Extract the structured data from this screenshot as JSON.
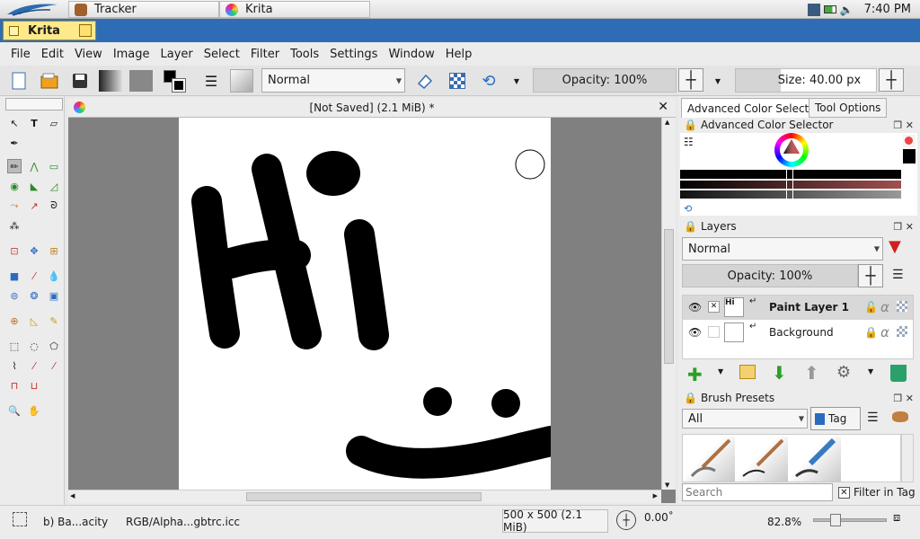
{
  "taskbar": {
    "tasks": [
      {
        "label": "Tracker"
      },
      {
        "label": "Krita"
      }
    ],
    "clock": "7:40 PM"
  },
  "window": {
    "title": "Krita"
  },
  "menu": [
    "File",
    "Edit",
    "View",
    "Image",
    "Layer",
    "Select",
    "Filter",
    "Tools",
    "Settings",
    "Window",
    "Help"
  ],
  "toolbar": {
    "blend_mode": "Normal",
    "opacity_label": "Opacity: 100%",
    "size_label": "Size: 40.00 px"
  },
  "document": {
    "tab_title": "[Not Saved]  (2.1 MiB) *",
    "text_hi": "Hi"
  },
  "panel": {
    "tab_color_selector": "Advanced Color Selector",
    "tab_tool_options": "Tool Options",
    "color_selector_title": "Advanced Color Selector",
    "layers_title": "Layers",
    "layers_blend": "Normal",
    "layers_opacity": "Opacity:  100%",
    "layers": [
      {
        "name": "Paint Layer 1",
        "selected": true
      },
      {
        "name": "Background",
        "selected": false
      }
    ],
    "brush_presets_title": "Brush Presets",
    "brush_filter": "All",
    "tag_label": "Tag",
    "search_placeholder": "Search",
    "filter_in_tag": "Filter in Tag"
  },
  "status": {
    "layer_info": "b) Ba...acity",
    "color_profile": "RGB/Alpha...gbtrc.icc",
    "image_size": "500 x 500 (2.1 MiB)",
    "rotation": "0.00˚",
    "zoom": "82.8%"
  },
  "colors": {
    "titlebar": "#2e6db5",
    "foreground": "#000000",
    "background": "#ffffff"
  }
}
